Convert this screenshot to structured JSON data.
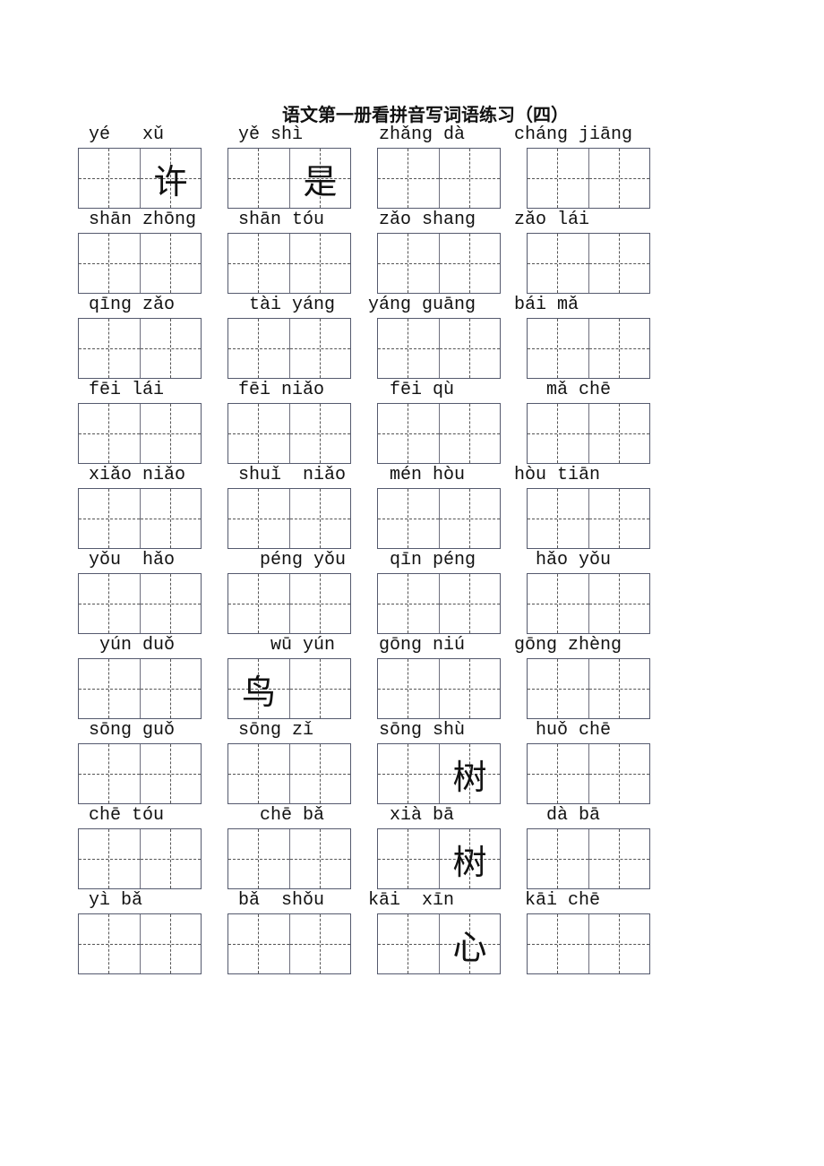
{
  "title": "语文第一册看拼音写词语练习（四）",
  "rows": [
    [
      {
        "pinyin": "yé   xǔ",
        "chars": [
          "",
          ""
        ]
      },
      {
        "pinyin": "yě shì",
        "chars": [
          "",
          ""
        ]
      },
      {
        "pinyin": " zhǎng dà",
        "chars": [
          "",
          ""
        ]
      },
      {
        "pinyin": "cháng jiāng",
        "chars": [
          "",
          ""
        ]
      }
    ],
    [
      {
        "pinyin": "shān zhōng",
        "chars": [
          "",
          ""
        ]
      },
      {
        "pinyin": "shān tóu",
        "chars": [
          "",
          ""
        ]
      },
      {
        "pinyin": " zǎo shang",
        "chars": [
          "",
          ""
        ]
      },
      {
        "pinyin": "zǎo lái",
        "chars": [
          "",
          ""
        ]
      }
    ],
    [
      {
        "pinyin": "qīng zǎo",
        "chars": [
          "",
          ""
        ]
      },
      {
        "pinyin": " tài yáng",
        "chars": [
          "",
          ""
        ]
      },
      {
        "pinyin": "yáng guāng",
        "chars": [
          "",
          ""
        ]
      },
      {
        "pinyin": "bái mǎ",
        "chars": [
          "",
          ""
        ]
      }
    ],
    [
      {
        "pinyin": "fēi lái",
        "chars": [
          "",
          ""
        ]
      },
      {
        "pinyin": "fēi niǎo",
        "chars": [
          "",
          ""
        ]
      },
      {
        "pinyin": "  fēi qù",
        "chars": [
          "",
          ""
        ]
      },
      {
        "pinyin": "   mǎ chē",
        "chars": [
          "",
          ""
        ]
      }
    ],
    [
      {
        "pinyin": "xiǎo niǎo",
        "chars": [
          "",
          ""
        ]
      },
      {
        "pinyin": "shuǐ  niǎo",
        "chars": [
          "",
          ""
        ]
      },
      {
        "pinyin": "  mén hòu",
        "chars": [
          "",
          ""
        ]
      },
      {
        "pinyin": "hòu tiān",
        "chars": [
          "",
          ""
        ]
      }
    ],
    [
      {
        "pinyin": "yǒu  hǎo",
        "chars": [
          "",
          ""
        ]
      },
      {
        "pinyin": "  péng yǒu",
        "chars": [
          "",
          ""
        ]
      },
      {
        "pinyin": "  qīn péng",
        "chars": [
          "",
          ""
        ]
      },
      {
        "pinyin": "  hǎo yǒu",
        "chars": [
          "",
          ""
        ]
      }
    ],
    [
      {
        "pinyin": " yún duǒ",
        "chars": [
          "",
          ""
        ]
      },
      {
        "pinyin": "   wū yún",
        "chars": [
          "鸟",
          ""
        ]
      },
      {
        "pinyin": " gōng niú",
        "chars": [
          "",
          ""
        ]
      },
      {
        "pinyin": "gōng zhèng",
        "chars": [
          "",
          ""
        ]
      }
    ],
    [
      {
        "pinyin": "sōng guǒ",
        "chars": [
          "",
          ""
        ]
      },
      {
        "pinyin": "sōng zǐ",
        "chars": [
          "",
          ""
        ]
      },
      {
        "pinyin": " sōng shù",
        "chars": [
          "",
          "树"
        ]
      },
      {
        "pinyin": "  huǒ chē",
        "chars": [
          "",
          ""
        ]
      }
    ],
    [
      {
        "pinyin": "chē tóu",
        "chars": [
          "",
          ""
        ]
      },
      {
        "pinyin": "  chē bǎ",
        "chars": [
          "",
          ""
        ]
      },
      {
        "pinyin": "  xià bā",
        "chars": [
          "",
          "树"
        ]
      },
      {
        "pinyin": "   dà bā",
        "chars": [
          "",
          ""
        ]
      }
    ],
    [
      {
        "pinyin": "yì bǎ",
        "chars": [
          "",
          ""
        ]
      },
      {
        "pinyin": "bǎ  shǒu",
        "chars": [
          "",
          ""
        ]
      },
      {
        "pinyin": "kāi  xīn",
        "chars": [
          "",
          "心"
        ]
      },
      {
        "pinyin": " kāi chē",
        "chars": [
          "",
          ""
        ]
      }
    ]
  ],
  "first_row_chars": [
    [
      "",
      "许"
    ],
    [
      "",
      "是"
    ]
  ]
}
